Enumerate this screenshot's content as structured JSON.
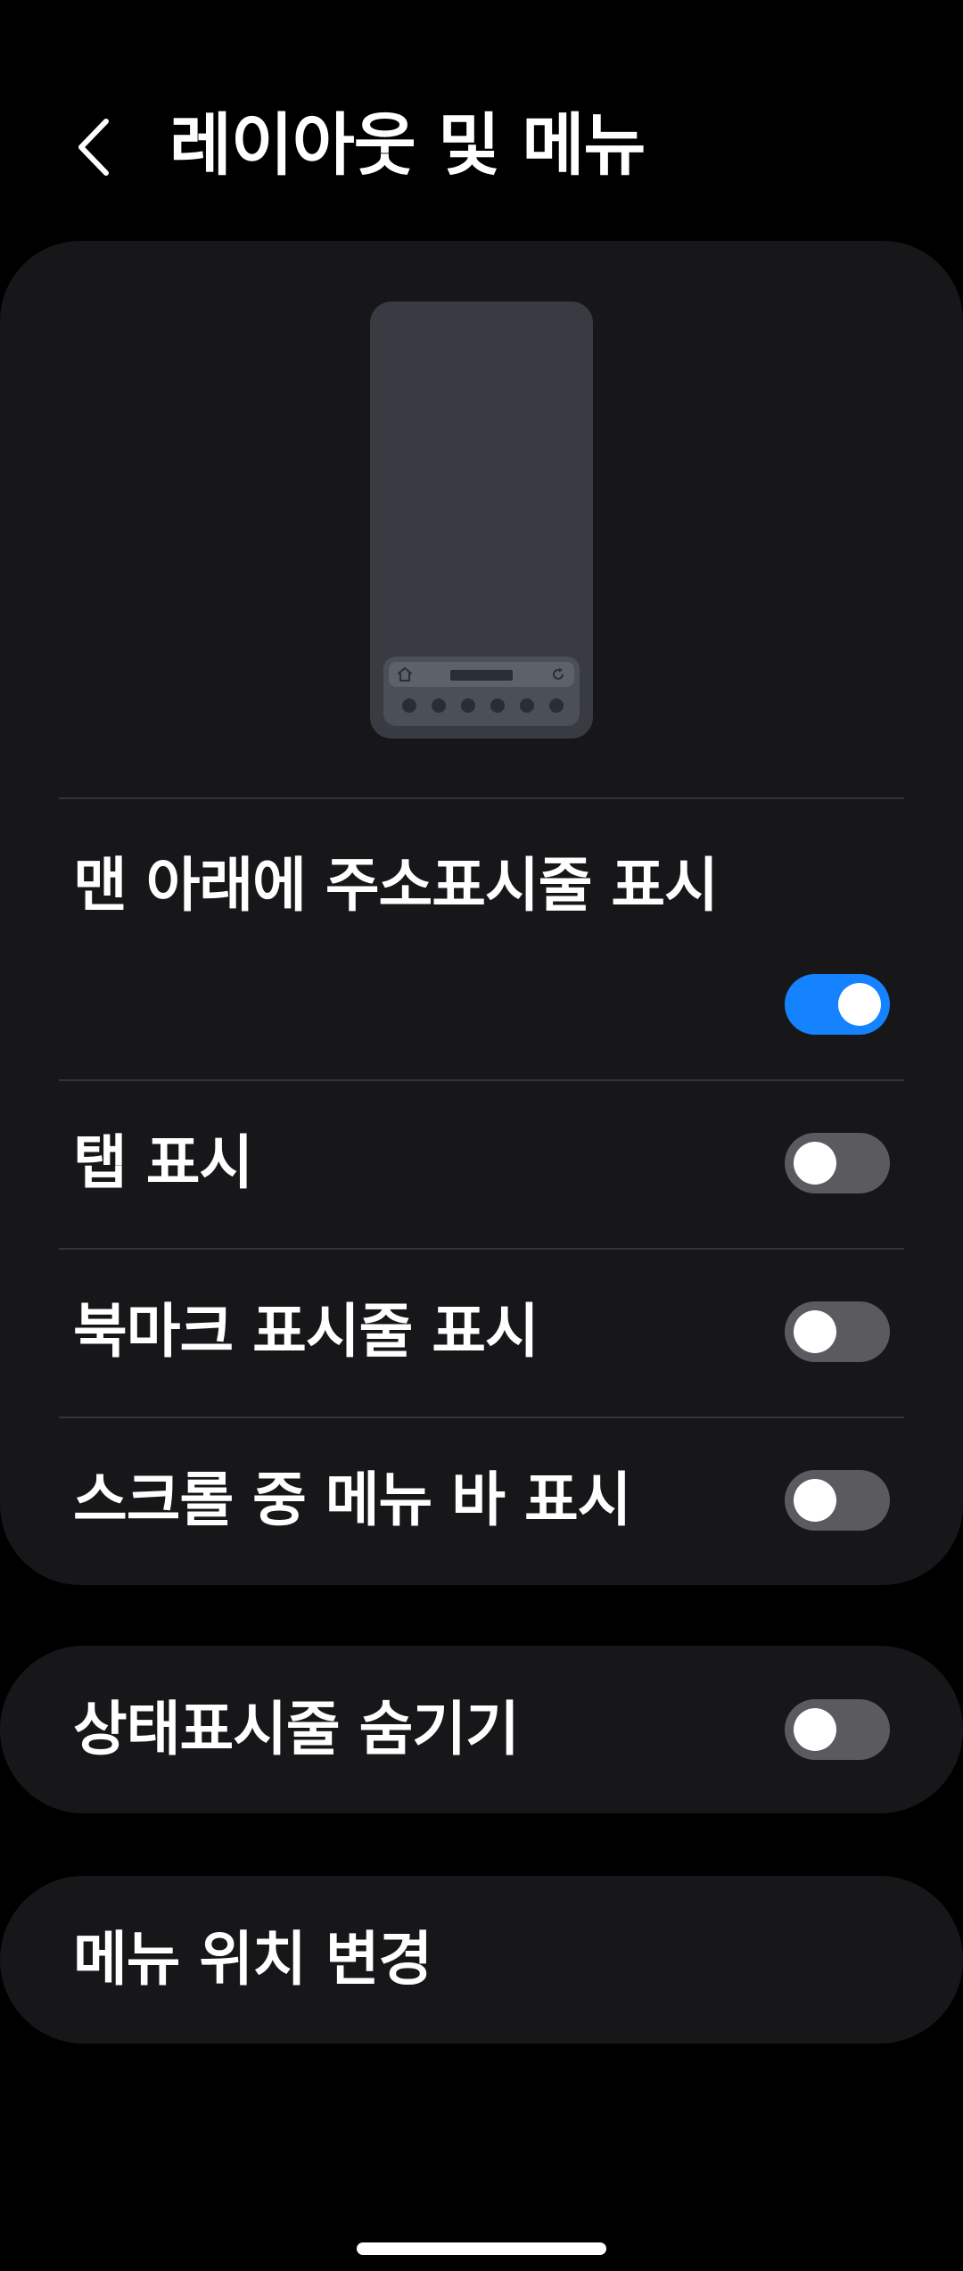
{
  "header": {
    "title": "레이아웃 및 메뉴",
    "back_icon": "chevron-left-icon"
  },
  "preview": {
    "icons": [
      "home-icon",
      "refresh-icon"
    ],
    "dot_count": 6
  },
  "settings": {
    "address_bar_bottom": {
      "label": "맨 아래에 주소표시줄 표시",
      "enabled": true
    },
    "show_tabs": {
      "label": "탭 표시",
      "enabled": false
    },
    "bookmark_bar": {
      "label": "북마크 표시줄 표시",
      "enabled": false
    },
    "menu_bar_scroll": {
      "label": "스크롤 중 메뉴 바 표시",
      "enabled": false
    },
    "hide_status_bar": {
      "label": "상태표시줄 숨기기",
      "enabled": false
    },
    "change_menu_position": {
      "label": "메뉴 위치 변경"
    }
  },
  "colors": {
    "background": "#000000",
    "card": "#17171a",
    "toggle_on": "#1582ff",
    "toggle_off": "#5a5a5f",
    "divider": "#33343a",
    "preview_phone": "#383c42"
  }
}
